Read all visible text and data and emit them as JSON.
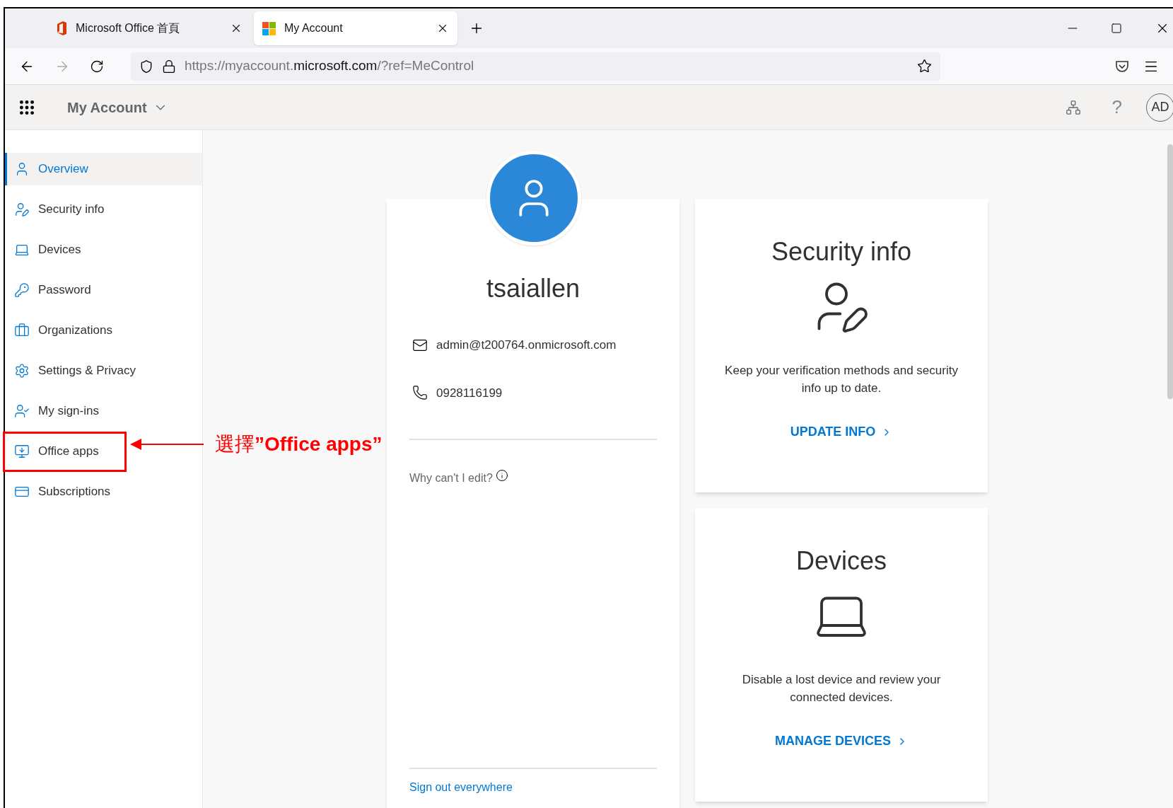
{
  "browser": {
    "tabs": [
      {
        "title": "Microsoft Office 首頁",
        "selected": false
      },
      {
        "title": "My Account",
        "selected": true
      }
    ],
    "address": {
      "prefix": "https://myaccount.",
      "domain": "microsoft.com",
      "suffix": "/?ref=MeControl"
    }
  },
  "app_header": {
    "title": "My Account",
    "help": "?",
    "avatar": "AD"
  },
  "sidebar": {
    "items": [
      {
        "label": "Overview",
        "selected": true
      },
      {
        "label": "Security info",
        "selected": false
      },
      {
        "label": "Devices",
        "selected": false
      },
      {
        "label": "Password",
        "selected": false
      },
      {
        "label": "Organizations",
        "selected": false
      },
      {
        "label": "Settings & Privacy",
        "selected": false
      },
      {
        "label": "My sign-ins",
        "selected": false
      },
      {
        "label": "Office apps",
        "selected": false,
        "highlighted": true
      },
      {
        "label": "Subscriptions",
        "selected": false
      }
    ]
  },
  "annotation": {
    "text": "選擇**”Office apps”**"
  },
  "profile": {
    "name": "tsaiallen",
    "email": "admin@t200764.onmicrosoft.com",
    "phone": "0928116199",
    "why_cant_edit": "Why can't I edit?",
    "sign_out": "Sign out everywhere"
  },
  "cards": [
    {
      "title": "Security info",
      "description": "Keep your verification methods and security info up to date.",
      "link": "UPDATE INFO"
    },
    {
      "title": "Devices",
      "description": "Disable a lost device and review your connected devices.",
      "link": "MANAGE DEVICES"
    }
  ]
}
